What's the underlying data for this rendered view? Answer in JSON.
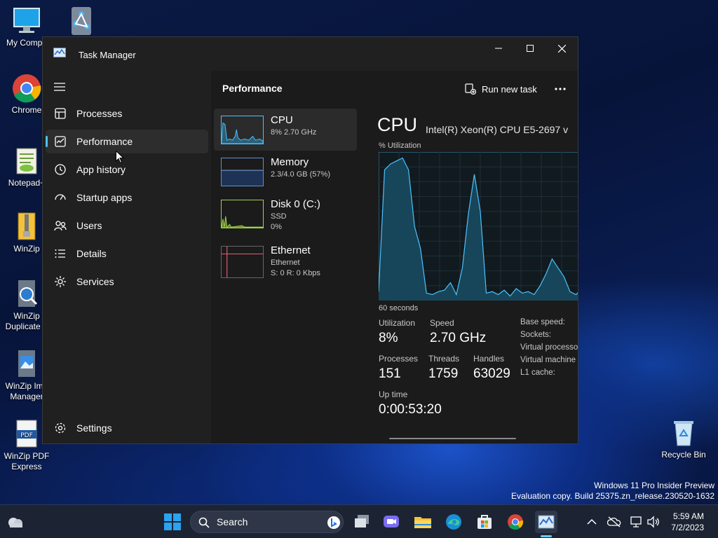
{
  "desktop": {
    "icons": [
      {
        "label": "My Compu",
        "icon": "computer-icon"
      },
      {
        "label": "",
        "icon": "network-share-icon"
      },
      {
        "label": "Chrome",
        "icon": "chrome-icon"
      },
      {
        "label": "Notepad+",
        "icon": "notepad-plus-icon"
      },
      {
        "label": "WinZip",
        "icon": "winzip-icon"
      },
      {
        "label": "WinZip Duplicate F",
        "icon": "winzip-duplicate-icon"
      },
      {
        "label": "WinZip Ima Manager",
        "icon": "winzip-image-icon"
      },
      {
        "label": "WinZip PDF Express",
        "icon": "winzip-pdf-icon"
      },
      {
        "label": "Recycle Bin",
        "icon": "recycle-bin-icon"
      }
    ]
  },
  "window": {
    "title": "Task Manager",
    "nav": [
      {
        "label": "Processes",
        "icon": "processes-icon"
      },
      {
        "label": "Performance",
        "icon": "performance-icon",
        "active": true
      },
      {
        "label": "App history",
        "icon": "history-icon"
      },
      {
        "label": "Startup apps",
        "icon": "startup-icon"
      },
      {
        "label": "Users",
        "icon": "users-icon"
      },
      {
        "label": "Details",
        "icon": "details-icon"
      },
      {
        "label": "Services",
        "icon": "services-icon"
      }
    ],
    "settings_label": "Settings",
    "page_title": "Performance",
    "run_new_task": "Run new task",
    "resources": [
      {
        "name": "CPU",
        "sub1": "8% 2.70 GHz",
        "sub2": "",
        "color": "#4cc2ff"
      },
      {
        "name": "Memory",
        "sub1": "2.3/4.0 GB (57%)",
        "sub2": "",
        "color": "#5c8fd6"
      },
      {
        "name": "Disk 0 (C:)",
        "sub1": "SSD",
        "sub2": "0%",
        "color": "#9fd14a"
      },
      {
        "name": "Ethernet",
        "sub1": "Ethernet",
        "sub2": "S: 0 R: 0 Kbps",
        "color": "#e25d6b"
      }
    ],
    "detail": {
      "heading": "CPU",
      "model": "Intel(R) Xeon(R) CPU E5-2697 v",
      "utilization_axis": "% Utilization",
      "time_axis": "60 seconds",
      "stats": {
        "utilization_label": "Utilization",
        "utilization_value": "8%",
        "speed_label": "Speed",
        "speed_value": "2.70 GHz",
        "processes_label": "Processes",
        "processes_value": "151",
        "threads_label": "Threads",
        "threads_value": "1759",
        "handles_label": "Handles",
        "handles_value": "63029",
        "uptime_label": "Up time",
        "uptime_value": "0:00:53:20"
      },
      "specs": [
        "Base speed:",
        "Sockets:",
        "Virtual processo",
        "Virtual machine",
        "L1 cache:"
      ],
      "cpu_history_percent": [
        6,
        88,
        92,
        94,
        96,
        88,
        50,
        35,
        5,
        4,
        6,
        7,
        12,
        4,
        22,
        58,
        85,
        60,
        5,
        6,
        4,
        7,
        3,
        8,
        5,
        6,
        4,
        10,
        18,
        28,
        22,
        16,
        6,
        4,
        8
      ]
    }
  },
  "watermark": {
    "line1": "Windows 11 Pro Insider Preview",
    "line2": "Evaluation copy. Build 25375.zn_release.230520-1632"
  },
  "taskbar": {
    "search_placeholder": "Search",
    "time": "5:59 AM",
    "date": "7/2/2023",
    "accent": "#60cdff"
  }
}
